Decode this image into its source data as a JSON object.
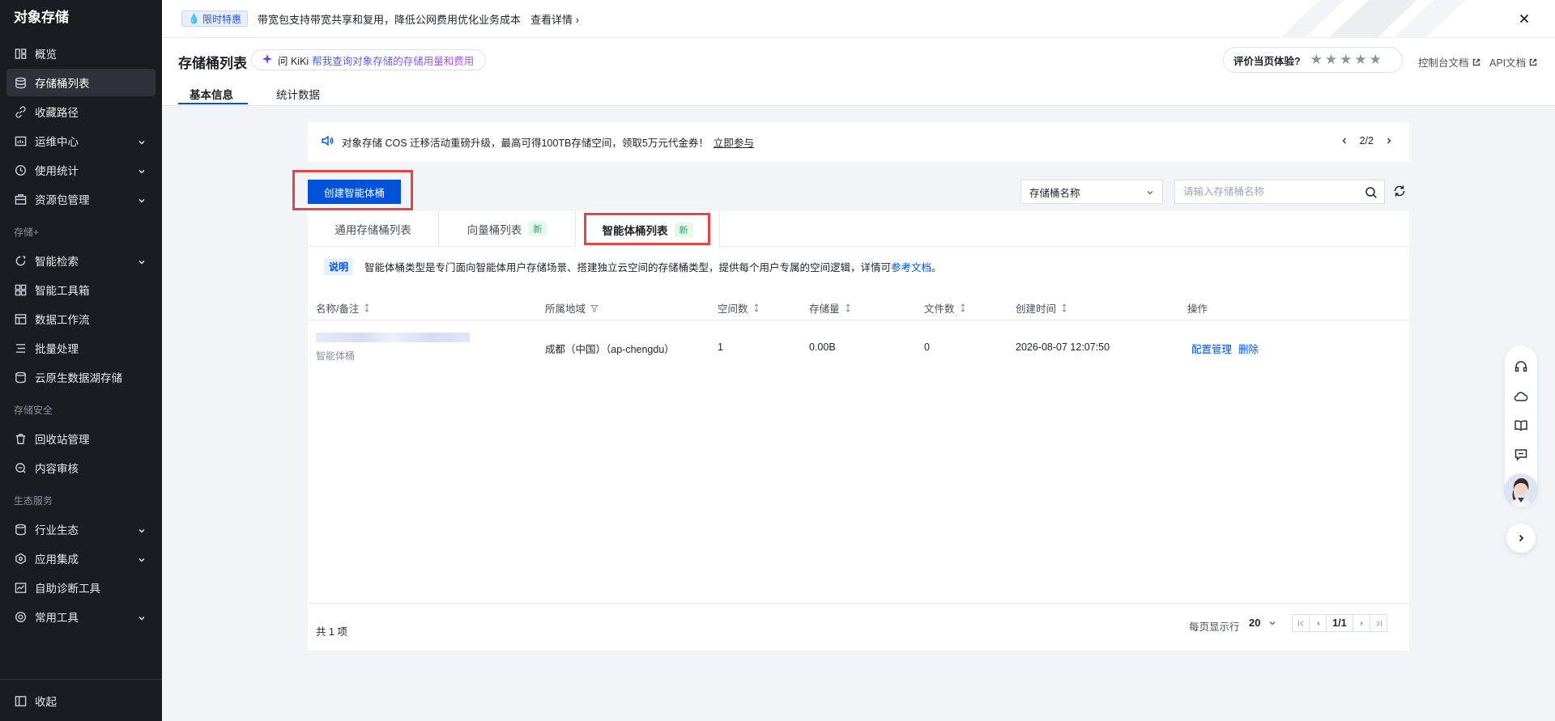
{
  "sidebar": {
    "title": "对象存储",
    "items": [
      {
        "label": "概览",
        "icon": "overview-icon"
      },
      {
        "label": "存储桶列表",
        "icon": "bucket-list-icon"
      },
      {
        "label": "收藏路径",
        "icon": "favorite-path-icon"
      },
      {
        "label": "运维中心",
        "icon": "ops-center-icon"
      },
      {
        "label": "使用统计",
        "icon": "usage-stats-icon"
      },
      {
        "label": "资源包管理",
        "icon": "resource-pack-icon"
      },
      {
        "label": "智能检索",
        "icon": "smart-search-icon"
      },
      {
        "label": "智能工具箱",
        "icon": "toolbox-icon"
      },
      {
        "label": "数据工作流",
        "icon": "workflow-icon"
      },
      {
        "label": "批量处理",
        "icon": "batch-icon"
      },
      {
        "label": "云原生数据湖存储",
        "icon": "datalake-icon"
      },
      {
        "label": "回收站管理",
        "icon": "recycle-bin-icon"
      },
      {
        "label": "内容审核",
        "icon": "content-audit-icon"
      },
      {
        "label": "行业生态",
        "icon": "industry-icon"
      },
      {
        "label": "应用集成",
        "icon": "integration-icon"
      },
      {
        "label": "自助诊断工具",
        "icon": "diagnosis-icon"
      },
      {
        "label": "常用工具",
        "icon": "tools-icon"
      }
    ],
    "groups": [
      "存储+",
      "存储安全",
      "生态服务"
    ],
    "collapse_label": "收起"
  },
  "banner": {
    "badge": "限时特惠",
    "text": "带宽包支持带宽共享和复用，降低公网费用优化业务成本",
    "link": "查看详情"
  },
  "header": {
    "title": "存储桶列表",
    "kiki_ask": "问 KiKi",
    "kiki_hint": "帮我查询对象存储的存储用量和费用",
    "tabs": [
      "基本信息",
      "统计数据"
    ],
    "rating_label": "评价当页体验?",
    "stars": "★★★★★",
    "doc_console": "控制台文档",
    "doc_api": "API文档"
  },
  "notice": {
    "text": "对象存储 COS 迁移活动重磅升级，最高可得100TB存储空间，领取5万元代金券！",
    "link": "立即参与",
    "page": "2/2"
  },
  "toolbar": {
    "create_label": "创建智能体桶",
    "select_value": "存储桶名称",
    "search_placeholder": "请输入存储桶名称"
  },
  "list_tabs": {
    "items": [
      "通用存储桶列表",
      "向量桶列表",
      "智能体桶列表"
    ],
    "new_badge": "新"
  },
  "description": {
    "tag": "说明",
    "text": "智能体桶类型是专门面向智能体用户存储场景、搭建独立云空间的存储桶类型，提供每个用户专属的空间逻辑，详情可",
    "link": "参考文档",
    "suffix": "。"
  },
  "table": {
    "columns": [
      "名称/备注",
      "所属地域",
      "空间数",
      "存储量",
      "文件数",
      "创建时间",
      "操作"
    ],
    "rows": [
      {
        "note": "智能体桶",
        "region": "成都（中国）（ap-chengdu）",
        "spaces": "1",
        "storage": "0.00B",
        "files": "0",
        "created": "2026-08-07 12:07:50",
        "action_config": "配置管理",
        "action_delete": "删除"
      }
    ]
  },
  "footer": {
    "total": "共 1 项",
    "per_page_label": "每页显示行",
    "page_size": "20",
    "page_info": "1/1"
  },
  "colors": {
    "primary": "#0052d9",
    "sidebar_bg": "#1b1c21",
    "highlight": "#e54545",
    "new_badge": "#2ba471"
  }
}
